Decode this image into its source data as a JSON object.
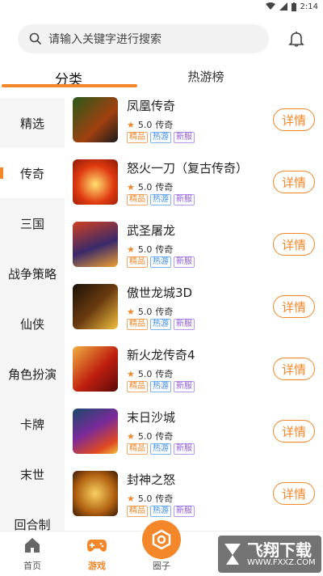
{
  "status_bar": {
    "time": "2:14"
  },
  "search": {
    "placeholder": "请输入关键字进行搜索"
  },
  "tabs": [
    {
      "label": "分类"
    },
    {
      "label": "热游榜"
    }
  ],
  "sidebar": {
    "items": [
      {
        "label": "精选"
      },
      {
        "label": "传奇"
      },
      {
        "label": "三国"
      },
      {
        "label": "战争策略"
      },
      {
        "label": "仙侠"
      },
      {
        "label": "角色扮演"
      },
      {
        "label": "卡牌"
      },
      {
        "label": "末世"
      },
      {
        "label": "回合制"
      }
    ],
    "active_index": 1
  },
  "games": [
    {
      "name": "凤凰传奇",
      "rating": "5.0",
      "genre": "传奇",
      "tags": [
        "精品",
        "热游",
        "新服"
      ],
      "button": "详情"
    },
    {
      "name": "怒火一刀（复古传奇）",
      "rating": "5.0",
      "genre": "传奇",
      "tags": [
        "精品",
        "热游",
        "新服"
      ],
      "button": "详情"
    },
    {
      "name": "武圣屠龙",
      "rating": "5.0",
      "genre": "传奇",
      "tags": [
        "精品",
        "热游",
        "新服"
      ],
      "button": "详情"
    },
    {
      "name": "傲世龙城3D",
      "rating": "5.0",
      "genre": "传奇",
      "tags": [
        "精品",
        "热游",
        "新服"
      ],
      "button": "详情"
    },
    {
      "name": "新火龙传奇4",
      "rating": "5.0",
      "genre": "传奇",
      "tags": [
        "精品",
        "热游",
        "新服"
      ],
      "button": "详情"
    },
    {
      "name": "末日沙城",
      "rating": "5.0",
      "genre": "传奇",
      "tags": [
        "精品",
        "热游",
        "新服"
      ],
      "button": "详情"
    },
    {
      "name": "封神之怒",
      "rating": "5.0",
      "genre": "传奇",
      "tags": [
        "精品",
        "热游",
        "新服"
      ],
      "button": "详情"
    }
  ],
  "bottom_nav": [
    {
      "label": "首页",
      "icon": "home-icon"
    },
    {
      "label": "游戏",
      "icon": "gamepad-icon"
    },
    {
      "label": "圈子",
      "icon": "circle-icon"
    }
  ],
  "watermark": {
    "text": "飞翔下载",
    "url": "WWW.FXXZ.COM"
  },
  "colors": {
    "accent": "#f3872a",
    "tag_hot": "#3d8de6",
    "tag_new": "#8d5be0"
  }
}
